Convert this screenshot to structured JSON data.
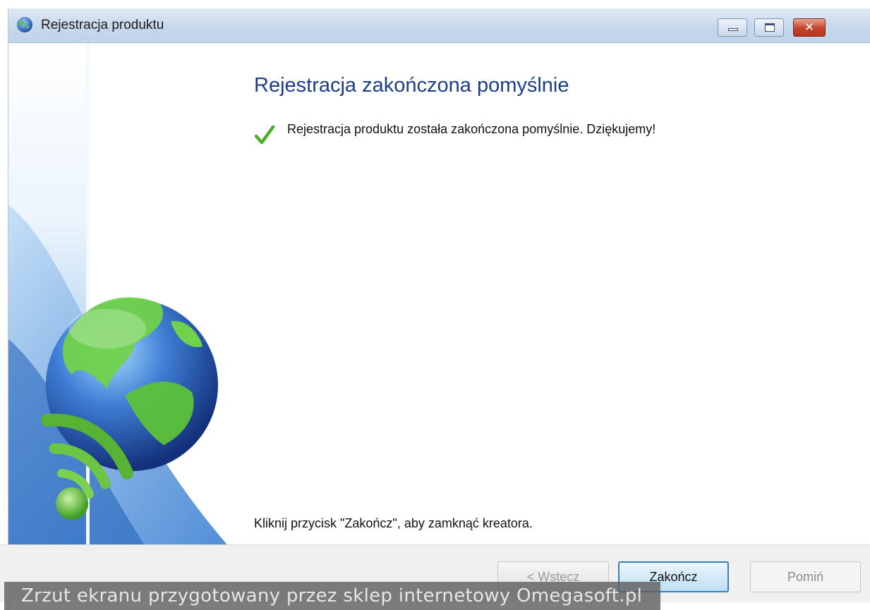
{
  "window": {
    "title": "Rejestracja produktu",
    "caption_buttons": {
      "minimize": "minimize-icon",
      "maximize": "maximize-icon",
      "close": "close-icon",
      "close_glyph": "✕"
    }
  },
  "main": {
    "heading": "Rejestracja zakończona pomyślnie",
    "success_message": "Rejestracja produktu została zakończona pomyślnie. Dziękujemy!",
    "instruction": "Kliknij przycisk \"Zakończ\", aby zamknąć kreatora."
  },
  "footer": {
    "back_label": "< Wstecz",
    "finish_label": "Zakończ",
    "skip_label": "Pomiń"
  },
  "watermark": "Zrzut ekranu przygotowany przez sklep internetowy Omegasoft.pl",
  "colors": {
    "heading": "#1c3e8a",
    "accent": "#3c7fb1",
    "check": "#4caf2a"
  },
  "icons": {
    "app": "globe-icon",
    "success": "checkmark-icon",
    "side_art": "globe-wireless-illustration"
  }
}
